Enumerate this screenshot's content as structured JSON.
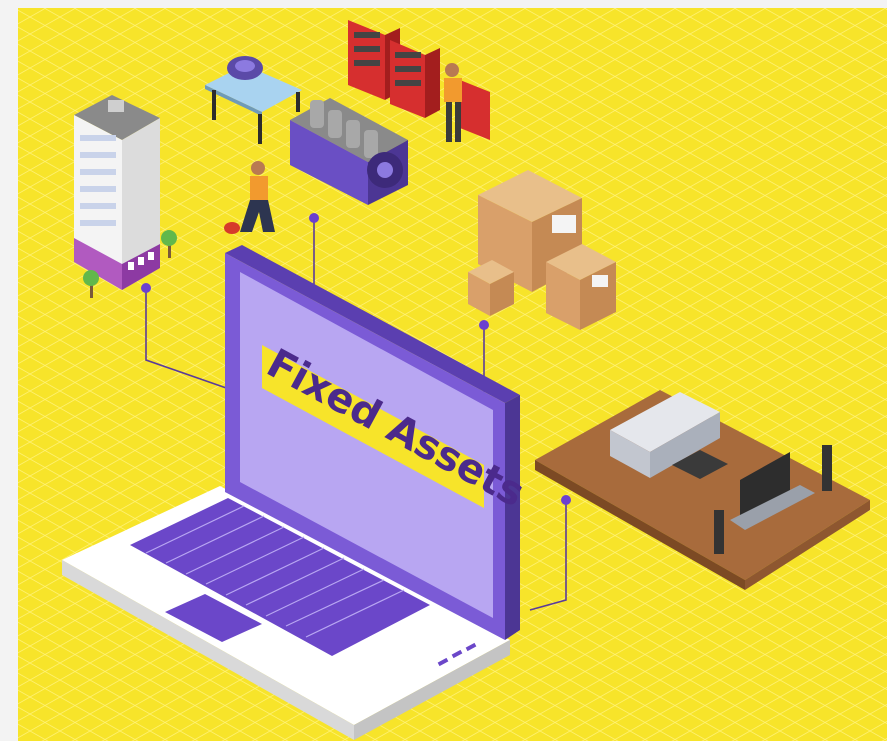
{
  "illustration": {
    "banner_text": "Fixed Assets",
    "colors": {
      "background": "#f7e42a",
      "laptop_body": "#ffffff",
      "laptop_screen": "#b8a6f2",
      "laptop_frame": "#7b5bd6",
      "keyboard": "#6b47c9",
      "banner": "#f7e42a",
      "banner_text": "#4b2a8c",
      "connector": "#5a3b9a"
    },
    "icons": [
      "office-building-icon",
      "engine-workshop-icon",
      "worker-icon",
      "tool-cabinet-icon",
      "cardboard-boxes-icon",
      "living-room-furniture-icon",
      "laptop-icon"
    ]
  }
}
